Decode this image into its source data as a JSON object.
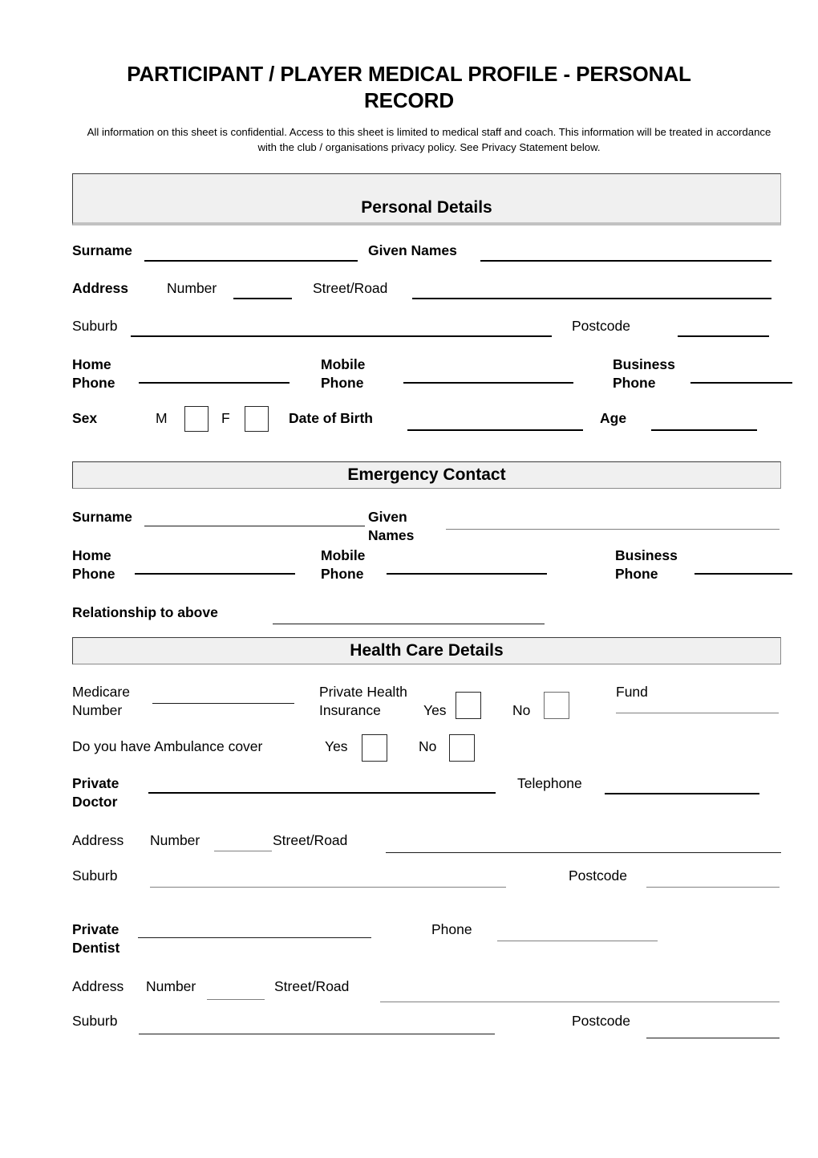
{
  "document": {
    "title": "PARTICIPANT / PLAYER MEDICAL PROFILE - PERSONAL RECORD",
    "subtitle": "All information on this sheet is confidential. Access to this sheet is limited to medical staff and coach. This information will be treated in accordance with the club / organisations privacy policy. See Privacy Statement below."
  },
  "sections": {
    "personal_details": {
      "heading": "Personal Details",
      "surname_label": "Surname",
      "given_names_label": "Given Names",
      "address_label": "Address",
      "number_label": "Number",
      "street_label": "Street/Road",
      "suburb_label": "Suburb",
      "postcode_label": "Postcode",
      "home_phone_label_1": "Home",
      "home_phone_label_2": "Phone",
      "mobile_phone_label_1": "Mobile",
      "mobile_phone_label_2": "Phone",
      "business_phone_label_1": "Business",
      "business_phone_label_2": "Phone",
      "sex_label": "Sex",
      "sex_male_label": "M",
      "sex_female_label": "F",
      "dob_label": "Date of Birth",
      "age_label": "Age"
    },
    "emergency_contact": {
      "heading": "Emergency Contact",
      "surname_label": "Surname",
      "given_names_label_1": "Given",
      "given_names_label_2": "Names",
      "home_phone_label_1": "Home",
      "home_phone_label_2": "Phone",
      "mobile_phone_label_1": "Mobile",
      "mobile_phone_label_2": "Phone",
      "business_phone_label_1": "Business",
      "business_phone_label_2": "Phone",
      "relationship_label": "Relationship to above"
    },
    "health_care_details": {
      "heading": "Health Care Details",
      "medicare_label_1": "Medicare",
      "medicare_label_2": "Number",
      "private_health_label_1": "Private Health",
      "private_health_label_2": "Insurance",
      "private_health_yes": "Yes",
      "private_health_no": "No",
      "fund_label": "Fund",
      "ambulance_label": "Do you have Ambulance cover",
      "ambulance_yes": "Yes",
      "ambulance_no": "No",
      "private_doctor_label_1": "Private",
      "private_doctor_label_2": "Doctor",
      "doctor_telephone_label": "Telephone",
      "doctor_address_label": "Address",
      "doctor_number_label": "Number",
      "doctor_street_label": "Street/Road",
      "doctor_suburb_label": "Suburb",
      "doctor_postcode_label": "Postcode",
      "private_dentist_label_1": "Private",
      "private_dentist_label_2": "Dentist",
      "dentist_phone_label": "Phone",
      "dentist_address_label": "Address",
      "dentist_number_label": "Number",
      "dentist_street_label": "Street/Road",
      "dentist_suburb_label": "Suburb",
      "dentist_postcode_label": "Postcode"
    }
  }
}
